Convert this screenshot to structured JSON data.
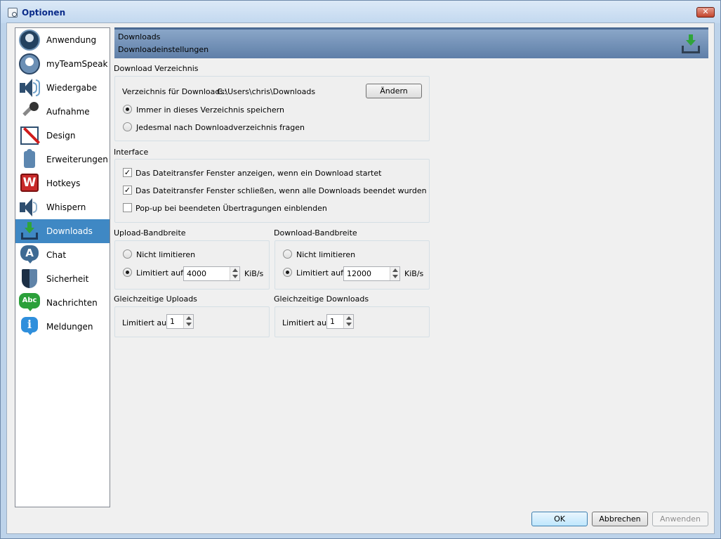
{
  "window": {
    "title": "Optionen",
    "close_symbol": "✕"
  },
  "sidebar": {
    "items": [
      {
        "label": "Anwendung",
        "icon": "headset-icon"
      },
      {
        "label": "myTeamSpeak",
        "icon": "user-icon"
      },
      {
        "label": "Wiedergabe",
        "icon": "speaker-icon"
      },
      {
        "label": "Aufnahme",
        "icon": "microphone-icon"
      },
      {
        "label": "Design",
        "icon": "design-icon"
      },
      {
        "label": "Erweiterungen",
        "icon": "puzzle-icon"
      },
      {
        "label": "Hotkeys",
        "icon": "hotkey-icon",
        "glyph": "W"
      },
      {
        "label": "Whispern",
        "icon": "whisper-icon"
      },
      {
        "label": "Downloads",
        "icon": "download-icon",
        "active": true
      },
      {
        "label": "Chat",
        "icon": "chat-icon",
        "glyph": "A"
      },
      {
        "label": "Sicherheit",
        "icon": "shield-icon"
      },
      {
        "label": "Nachrichten",
        "icon": "messages-icon",
        "glyph": "Abc"
      },
      {
        "label": "Meldungen",
        "icon": "info-icon",
        "glyph": "i"
      }
    ]
  },
  "banner": {
    "title": "Downloads",
    "subtitle": "Downloadeinstellungen"
  },
  "download_dir": {
    "heading": "Download Verzeichnis",
    "label": "Verzeichnis für Downloads:",
    "path": "C:\\Users\\chris\\Downloads",
    "change_button": "Ändern",
    "option_always": "Immer in dieses Verzeichnis speichern",
    "option_ask": "Jedesmal nach Downloadverzeichnis fragen",
    "selected": "always"
  },
  "interface": {
    "heading": "Interface",
    "options": [
      {
        "label": "Das Dateitransfer Fenster anzeigen, wenn ein Download startet",
        "checked": true
      },
      {
        "label": "Das Dateitransfer Fenster schließen, wenn alle Downloads beendet wurden",
        "checked": true
      },
      {
        "label": "Pop-up bei beendeten Übertragungen einblenden",
        "checked": false
      }
    ],
    "check_mark": "✓"
  },
  "upload_bw": {
    "heading": "Upload-Bandbreite",
    "option_unlimited": "Nicht limitieren",
    "option_limited": "Limitiert auf",
    "value": "4000",
    "unit": "KiB/s",
    "selected": "limited"
  },
  "download_bw": {
    "heading": "Download-Bandbreite",
    "option_unlimited": "Nicht limitieren",
    "option_limited": "Limitiert auf",
    "value": "12000",
    "unit": "KiB/s",
    "selected": "limited"
  },
  "concurrent_uploads": {
    "heading": "Gleichzeitige Uploads",
    "label": "Limitiert auf",
    "value": "1"
  },
  "concurrent_downloads": {
    "heading": "Gleichzeitige Downloads",
    "label": "Limitiert auf",
    "value": "1"
  },
  "footer": {
    "ok": "OK",
    "cancel": "Abbrechen",
    "apply": "Anwenden"
  },
  "colors": {
    "active_nav": "#3f88c4",
    "banner": "#6f8fb6",
    "download_arrow": "#2fa43a"
  }
}
